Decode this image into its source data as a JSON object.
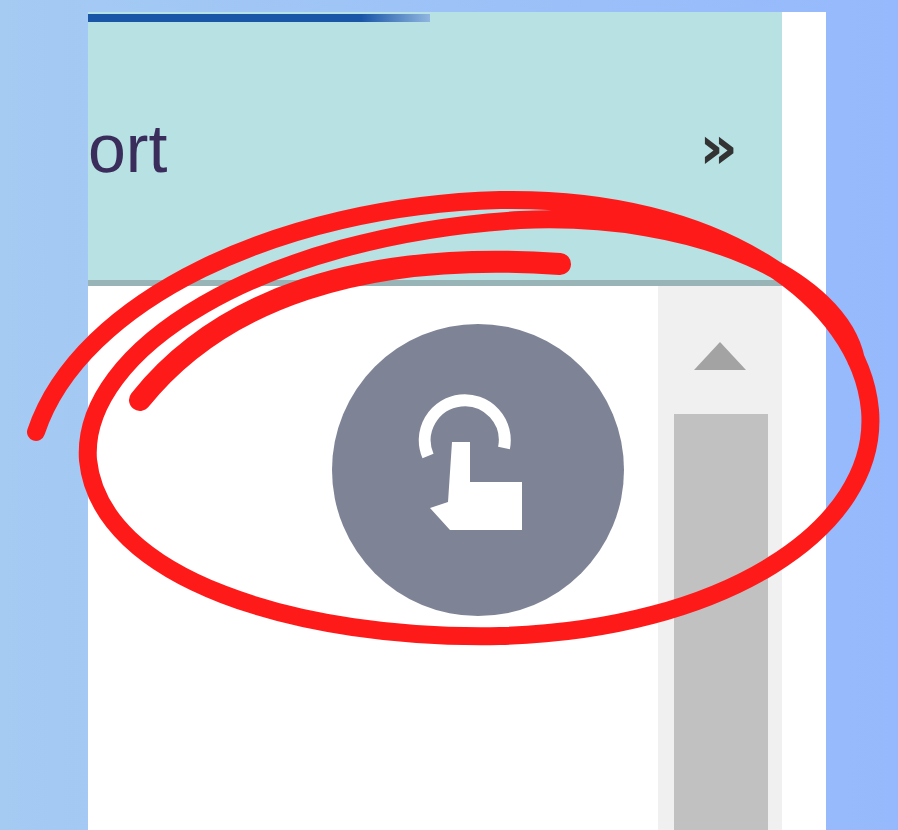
{
  "header": {
    "title": "ort",
    "more_button": "»"
  }
}
